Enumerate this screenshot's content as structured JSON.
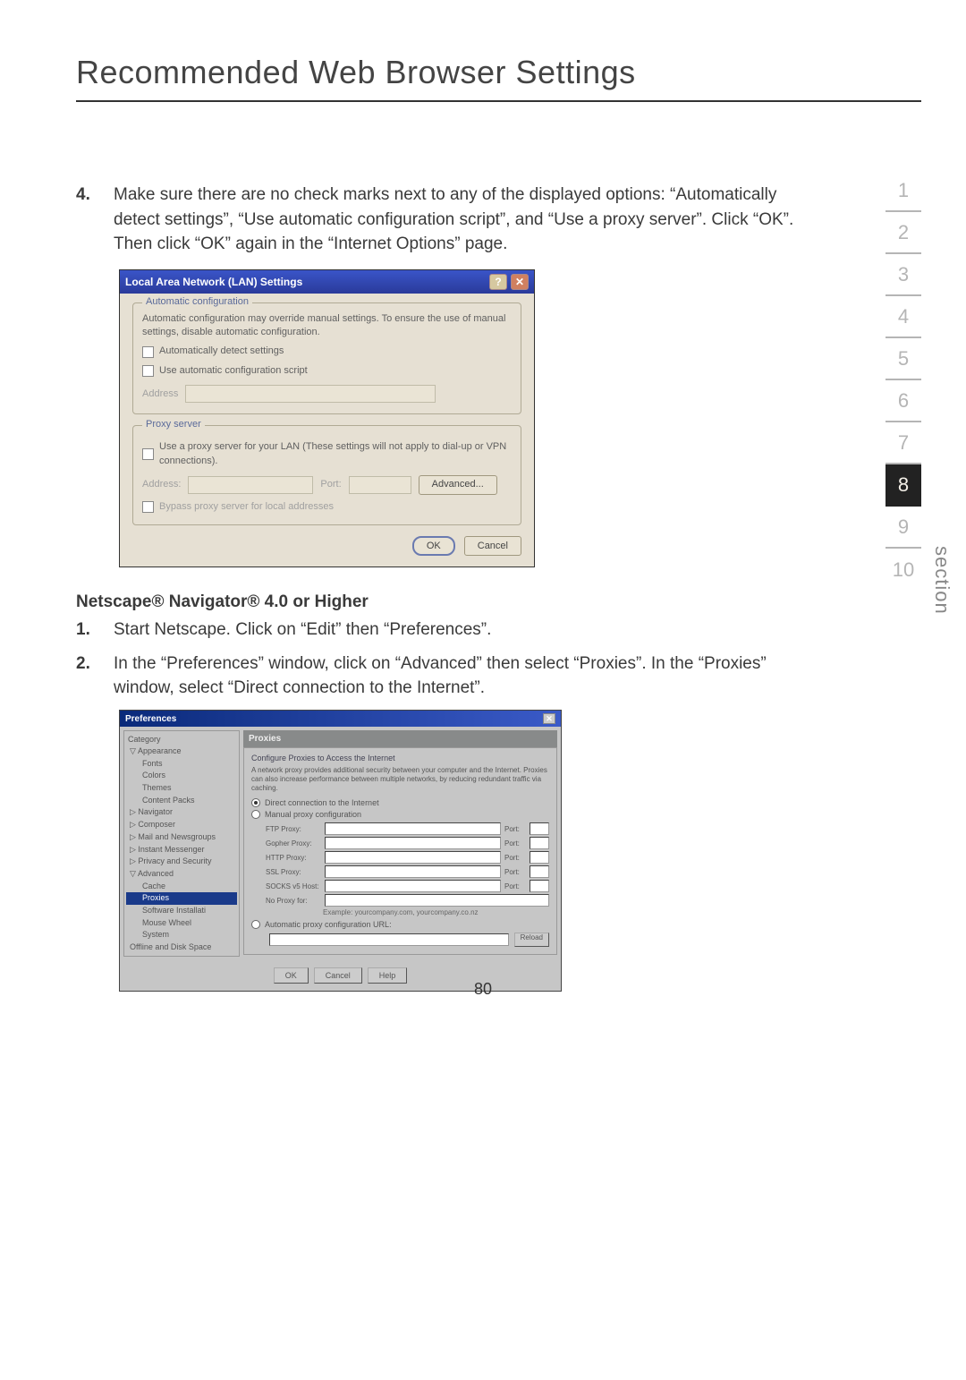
{
  "title": "Recommended Web Browser Settings",
  "pagenum": "80",
  "section_label": "section",
  "tabs": [
    "1",
    "2",
    "3",
    "4",
    "5",
    "6",
    "7",
    "8",
    "9",
    "10"
  ],
  "active_tab": "8",
  "step4": {
    "num": "4.",
    "text": "Make sure there are no check marks next to any of the displayed options: “Automatically detect settings”, “Use automatic configuration script”, and “Use a proxy server”. Click “OK”. Then click “OK” again in the “Internet Options” page."
  },
  "lan_dialog": {
    "title": "Local Area Network (LAN) Settings",
    "help_btn": "?",
    "close_btn": "✕",
    "autoconf_legend": "Automatic configuration",
    "autoconf_desc": "Automatic configuration may override manual settings. To ensure the use of manual settings, disable automatic configuration.",
    "cb_autodetect": "Automatically detect settings",
    "cb_autoscript": "Use automatic configuration script",
    "address_lbl": "Address",
    "proxy_legend": "Proxy server",
    "cb_proxy": "Use a proxy server for your LAN (These settings will not apply to dial-up or VPN connections).",
    "addr2_lbl": "Address:",
    "port_lbl": "Port:",
    "adv_btn": "Advanced...",
    "cb_bypass": "Bypass proxy server for local addresses",
    "ok_btn": "OK",
    "cancel_btn": "Cancel"
  },
  "netscape_heading": "Netscape® Navigator® 4.0 or Higher",
  "step_ns1": {
    "num": "1.",
    "text": "Start Netscape. Click on “Edit” then “Preferences”."
  },
  "step_ns2": {
    "num": "2.",
    "text": "In the “Preferences” window, click on “Advanced” then select “Proxies”. In the “Proxies” window, select “Direct connection to the Internet”."
  },
  "prefs": {
    "title": "Preferences",
    "close": "✕",
    "category_lbl": "Category",
    "tree": [
      "Appearance",
      "Fonts",
      "Colors",
      "Themes",
      "Content Packs",
      "Navigator",
      "Composer",
      "Mail and Newsgroups",
      "Instant Messenger",
      "Privacy and Security",
      "Advanced",
      "Cache",
      "Proxies",
      "Software Installati",
      "Mouse Wheel",
      "System",
      "Offline and Disk Space"
    ],
    "panel_title": "Proxies",
    "panel_sub": "Configure Proxies to Access the Internet",
    "panel_desc": "A network proxy provides additional security between your computer and the Internet. Proxies can also increase performance between multiple networks, by reducing redundant traffic via caching.",
    "radio_direct": "Direct connection to the Internet",
    "radio_manual": "Manual proxy configuration",
    "rows": [
      {
        "label": "FTP Proxy:",
        "port": "Port:"
      },
      {
        "label": "Gopher Proxy:",
        "port": "Port:"
      },
      {
        "label": "HTTP Proxy:",
        "port": "Port:"
      },
      {
        "label": "SSL Proxy:",
        "port": "Port:"
      },
      {
        "label": "SOCKS v5 Host:",
        "port": "Port:"
      },
      {
        "label": "No Proxy for:",
        "port": ""
      }
    ],
    "example": "Example: yourcompany.com, yourcompany.co.nz",
    "radio_auto": "Automatic proxy configuration URL:",
    "reload_btn": "Reload",
    "ok_btn": "OK",
    "cancel_btn": "Cancel",
    "help_btn": "Help"
  }
}
